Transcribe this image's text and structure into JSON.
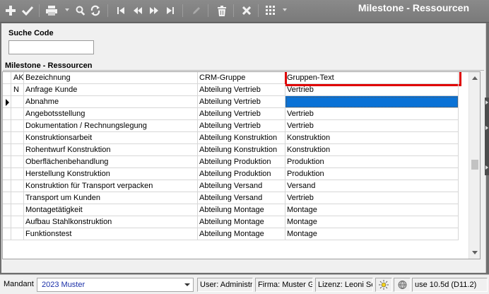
{
  "window": {
    "title": "Milestone - Ressourcen"
  },
  "toolbar": {
    "buttons": [
      {
        "name": "add-icon"
      },
      {
        "name": "save-check-icon"
      },
      {
        "name": "print-icon"
      },
      {
        "name": "search-zoom-icon"
      },
      {
        "name": "refresh-icon"
      },
      {
        "name": "first-record-icon"
      },
      {
        "name": "previous-record-icon"
      },
      {
        "name": "next-record-icon"
      },
      {
        "name": "last-record-icon"
      },
      {
        "name": "edit-pencil-icon"
      },
      {
        "name": "delete-trash-icon"
      },
      {
        "name": "cancel-x-icon"
      },
      {
        "name": "grid-view-icon"
      }
    ]
  },
  "search": {
    "label": "Suche Code",
    "value": "",
    "placeholder": ""
  },
  "grid": {
    "title": "Milestone - Ressourcen",
    "columns": {
      "ak": "AK",
      "bezeichnung": "Bezeichnung",
      "crm": "CRM-Gruppe",
      "gruppen_text": "Gruppen-Text"
    },
    "rows": [
      {
        "ak": "N",
        "bezeichnung": "Anfrage Kunde",
        "crm": "Abteilung Vertrieb",
        "gruppen_text": "Vertrieb"
      },
      {
        "ak": "",
        "bezeichnung": "Abnahme",
        "crm": "Abteilung Vertrieb",
        "gruppen_text": ""
      },
      {
        "ak": "",
        "bezeichnung": "Angebotsstellung",
        "crm": "Abteilung Vertrieb",
        "gruppen_text": "Vertrieb"
      },
      {
        "ak": "",
        "bezeichnung": "Dokumentation / Rechnungslegung",
        "crm": "Abteilung Vertrieb",
        "gruppen_text": "Vertrieb"
      },
      {
        "ak": "",
        "bezeichnung": "Konstruktionsarbeit",
        "crm": "Abteilung Konstruktion",
        "gruppen_text": "Konstruktion"
      },
      {
        "ak": "",
        "bezeichnung": "Rohentwurf Konstruktion",
        "crm": "Abteilung Konstruktion",
        "gruppen_text": "Konstruktion"
      },
      {
        "ak": "",
        "bezeichnung": "Oberflächenbehandlung",
        "crm": "Abteilung Produktion",
        "gruppen_text": "Produktion"
      },
      {
        "ak": "",
        "bezeichnung": "Herstellung Konstruktion",
        "crm": "Abteilung Produktion",
        "gruppen_text": "Produktion"
      },
      {
        "ak": "",
        "bezeichnung": "Konstruktion für Transport verpacken",
        "crm": "Abteilung Versand",
        "gruppen_text": "Versand"
      },
      {
        "ak": "",
        "bezeichnung": "Transport um Kunden",
        "crm": "Abteilung Versand",
        "gruppen_text": "Vertrieb"
      },
      {
        "ak": "",
        "bezeichnung": "Montagetätigkeit",
        "crm": "Abteilung Montage",
        "gruppen_text": "Montage"
      },
      {
        "ak": "",
        "bezeichnung": "Aufbau Stahlkonstruktion",
        "crm": "Abteilung Montage",
        "gruppen_text": "Montage"
      },
      {
        "ak": "",
        "bezeichnung": "Funktionstest",
        "crm": "Abteilung Montage",
        "gruppen_text": "Montage"
      }
    ],
    "selected_row": 1,
    "highlight_color": "#e00000",
    "selection_color": "#0a72d6"
  },
  "statusbar": {
    "mandant_label": "Mandant",
    "mandant_value": "2023 Muster",
    "user": "User: Administra",
    "firma": "Firma: Muster Gı",
    "lizenz": "Lizenz: Leoni Se",
    "version": "use 10.5d (D11.2)",
    "icons": [
      "sun-icon",
      "globe-icon"
    ]
  }
}
